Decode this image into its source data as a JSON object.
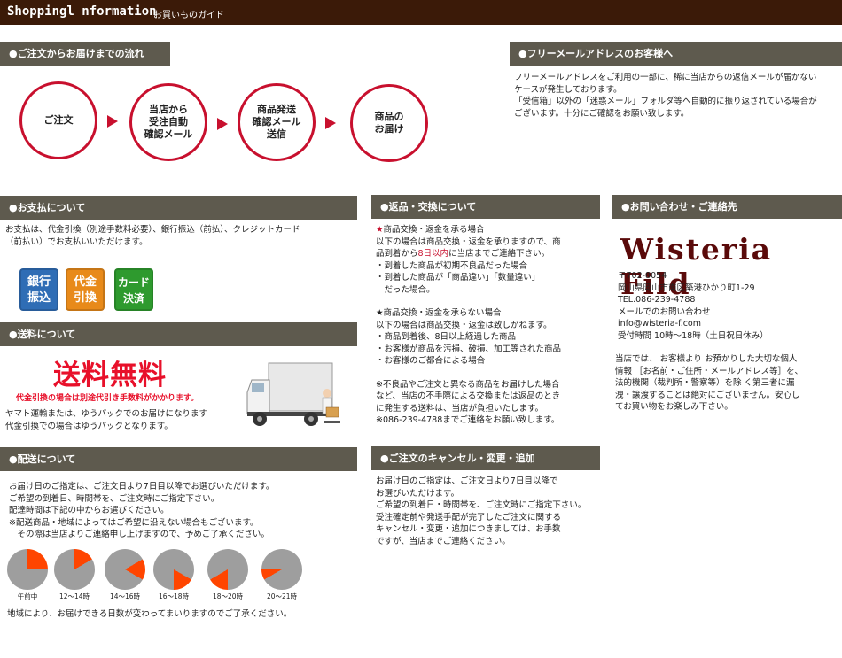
{
  "topbar": {
    "title": "Shoppingl nformation",
    "subtitle": "お買いものガイド"
  },
  "flow": {
    "header": "●ご注文からお届けまでの流れ",
    "steps": [
      "ご注文",
      "当店から\n受注自動\n確認メール",
      "商品発送\n確認メール\n送信",
      "商品の\nお届け"
    ]
  },
  "free_mail": {
    "header": "●フリーメールアドレスのお客様へ",
    "lines": [
      "フリーメールアドレスをご利用の一部に、稀に当店からの返信メールが届かない",
      "ケースが発生しております。",
      "「受信箱」以外の「迷惑メール」フォルダ等へ自動的に振り返されている場合が",
      "ございます。十分にご確認をお願い致します。"
    ]
  },
  "payment": {
    "header": "●お支払について",
    "lines": [
      "お支払は、代金引換（別途手数料必要）、銀行振込（前払）、クレジットカード",
      "（前払い）でお支払いいただけます。"
    ],
    "buttons": [
      {
        "label": "銀行\n振込",
        "color": "#2f6db5"
      },
      {
        "label": "代金\n引換",
        "color": "#e88a1a"
      },
      {
        "label": "カード\n決済",
        "color": "#2e9a2e"
      }
    ]
  },
  "shipping_fee": {
    "header": "●送料について",
    "banner": "送料無料",
    "note": "代金引換の場合は別途代引き手数料がかかります。",
    "lines": [
      "ヤマト運輸または、ゆうパックでのお届けになります",
      "代金引換での場合はゆうパックとなります。"
    ]
  },
  "delivery": {
    "header": "●配送について",
    "lines": [
      "お届け日のご指定は、ご注文日より7日目以降でお選びいただけます。",
      "ご希望の到着日、時間帯を、ご注文時にご指定下さい。",
      "配達時間は下記の中からお選びください。",
      "※配送商品・地域によってはご希望に沿えない場合もございます。",
      "　その際は当店よりご連絡申し上げますので、予めご了承ください。"
    ],
    "slots": [
      {
        "label": "午前中",
        "from": 0.0,
        "to": 0.25
      },
      {
        "label": "12〜14時",
        "from": 0.0,
        "to": 0.167
      },
      {
        "label": "14〜16時",
        "from": 0.167,
        "to": 0.333
      },
      {
        "label": "16〜18時",
        "from": 0.333,
        "to": 0.5
      },
      {
        "label": "18〜20時",
        "from": 0.5,
        "to": 0.667
      },
      {
        "label": "20〜21時",
        "from": 0.667,
        "to": 0.75
      }
    ],
    "footer": "地域により、お届けできる日数が変わってまいりますのでご了承ください。",
    "pie_gray": "#9e9e9e",
    "pie_accent": "#ff4500"
  },
  "returns": {
    "header": "●返品・交換について",
    "block1_title": "商品交換・返金を承る場合",
    "block1_lines": [
      "以下の場合は商品交換・返金を承りますので、商",
      "品到着から",
      "8日以内",
      "に当店までご連絡下さい。",
      "・到着した商品が初期不良品だった場合",
      "・到着した商品が「商品違い」「数量違い」",
      "　だった場合。"
    ],
    "block2_title": "★商品交換・返金を承らない場合",
    "block2_lines": [
      "以下の場合は商品交換・返金は致しかねます。",
      "・商品到着後、8日以上経過した商品",
      "・お客様が商品を汚損、破損、加工等された商品",
      "・お客様のご都合による場合"
    ],
    "block3_lines": [
      "※不良品やご注文と異なる商品をお届けした場合",
      "など、当店の不手際による交換または返品のとき",
      "に発生する送料は、当店が負担いたします。",
      "※086-239-4788までご連絡をお願い致します。"
    ]
  },
  "cancel": {
    "header": "●ご注文のキャンセル・変更・追加",
    "lines": [
      "お届け日のご指定は、ご注文日より7日目以降で",
      "お選びいただけます。",
      "ご希望の到着日・時間帯を、ご注文時にご指定下さい。",
      "受注確定前や発送手配が完了したご注文に関する",
      "キャンセル・変更・追加につきましては、お手数",
      "ですが、当店までご連絡ください。"
    ]
  },
  "contact": {
    "header": "●お問い合わせ・ご連絡先",
    "logo": "Wisteria Fild",
    "lines": [
      "〒702-8054",
      "岡山県岡山市南区築港ひかり町1-29",
      "TEL.086-239-4788",
      "メールでのお問い合わせ",
      "info@wisteria-f.com",
      "受付時間 10時〜18時（土日祝日休み）"
    ],
    "privacy_lines": [
      "当店では、 お客様より お預かりした大切な個人",
      "情報 ［お名前・ご住所・メールアドレス等］を、",
      "法的機関（裁判所・警察等）を除 く第三者に漏",
      "洩・譲渡することは絶対にございません。安心し",
      "てお買い物をお楽しみ下さい。"
    ]
  }
}
